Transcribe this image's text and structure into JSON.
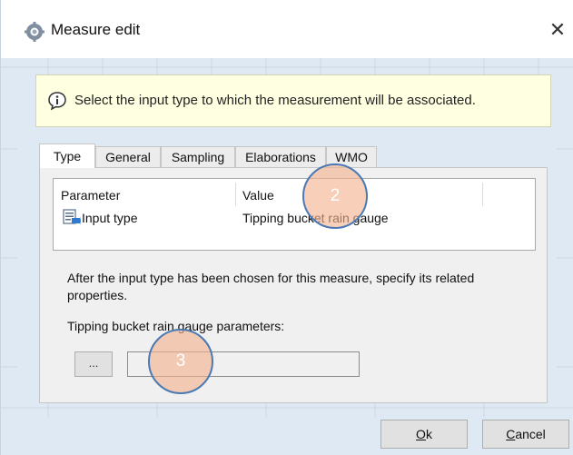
{
  "window": {
    "title": "Measure edit",
    "close_glyph": "✕",
    "title_icon": "gear-icon"
  },
  "info": {
    "icon": "info-speech-icon",
    "text": "Select the input type to which the measurement will be associated."
  },
  "tabs": [
    {
      "label": "Type",
      "active": true
    },
    {
      "label": "General",
      "active": false
    },
    {
      "label": "Sampling",
      "active": false
    },
    {
      "label": "Elaborations",
      "active": false
    },
    {
      "label": "WMO",
      "active": false
    }
  ],
  "grid": {
    "columns": [
      "Parameter",
      "Value"
    ],
    "rows": [
      {
        "icon": "properties-icon",
        "parameter": "Input type",
        "value": "Tipping bucket rain gauge"
      }
    ]
  },
  "description": "After the input type has been chosen for this measure, specify its related properties.",
  "parameters": {
    "label": "Tipping bucket rain gauge parameters:",
    "button_label": "...",
    "field_value": ""
  },
  "buttons": {
    "ok": {
      "accel": "O",
      "rest": "k"
    },
    "cancel": {
      "accel": "C",
      "rest": "ancel"
    }
  },
  "callouts": [
    {
      "label": "2"
    },
    {
      "label": "3"
    }
  ],
  "colors": {
    "info_bg": "#ffffe1",
    "window_bg": "#dfe9f3",
    "callout_fill": "#f3b18c",
    "callout_border": "#4a7ab5"
  }
}
